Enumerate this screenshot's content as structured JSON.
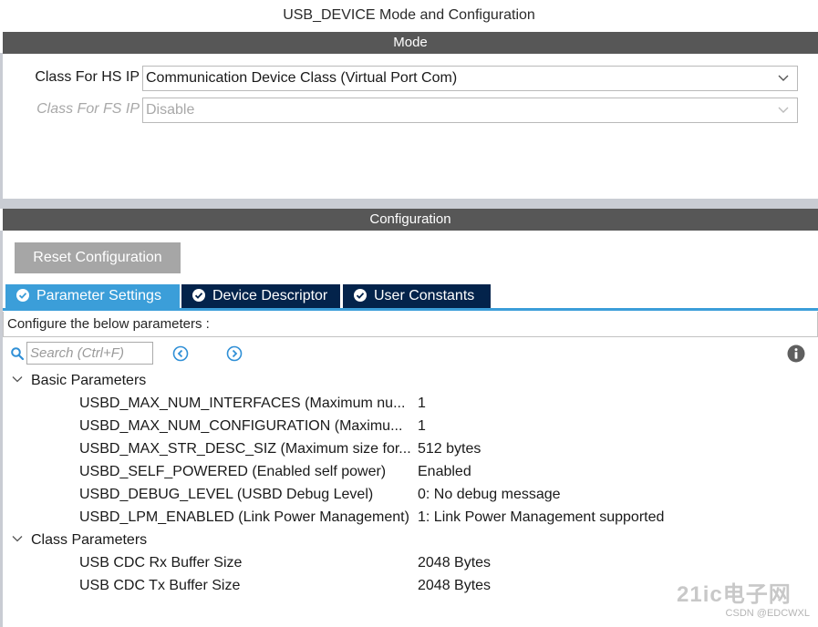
{
  "window": {
    "title": "USB_DEVICE Mode and Configuration"
  },
  "mode": {
    "header": "Mode",
    "hs": {
      "label": "Class For HS IP",
      "value": "Communication Device Class (Virtual Port Com)"
    },
    "fs": {
      "label": "Class For FS IP",
      "value": "Disable"
    }
  },
  "configuration": {
    "header": "Configuration",
    "reset_label": "Reset Configuration",
    "tabs": [
      {
        "label": "Parameter Settings",
        "active": true
      },
      {
        "label": "Device Descriptor",
        "active": false
      },
      {
        "label": "User Constants",
        "active": false
      }
    ],
    "configure_text": "Configure the below parameters :",
    "search": {
      "placeholder": "Search (Ctrl+F)"
    },
    "groups": [
      {
        "name": "Basic Parameters",
        "params": [
          {
            "name": "USBD_MAX_NUM_INTERFACES (Maximum nu...",
            "value": "1"
          },
          {
            "name": "USBD_MAX_NUM_CONFIGURATION (Maximu...",
            "value": "1"
          },
          {
            "name": "USBD_MAX_STR_DESC_SIZ (Maximum size for...",
            "value": "512 bytes"
          },
          {
            "name": "USBD_SELF_POWERED (Enabled self power)",
            "value": "Enabled"
          },
          {
            "name": "USBD_DEBUG_LEVEL (USBD Debug Level)",
            "value": "0: No debug message"
          },
          {
            "name": "USBD_LPM_ENABLED (Link Power Management)",
            "value": "1: Link Power Management supported"
          }
        ]
      },
      {
        "name": "Class Parameters",
        "params": [
          {
            "name": "USB CDC Rx Buffer Size",
            "value": "2048 Bytes"
          },
          {
            "name": "USB CDC Tx Buffer Size",
            "value": "2048 Bytes"
          }
        ]
      }
    ]
  },
  "watermark": {
    "text": "21ic电子网",
    "sub": "CSDN @EDCWXL"
  },
  "icons": {
    "search": "search-icon",
    "prev": "chevron-left-circle-icon",
    "next": "chevron-right-circle-icon",
    "info": "info-icon",
    "tab_tick": "check-circle-icon",
    "dropdown": "chevron-down-icon",
    "group_toggle": "caret-down-icon"
  },
  "colors": {
    "section_bar": "#575757",
    "tab_active": "#3b9ed9",
    "tab_inactive": "#03234b",
    "accent_icon": "#2f8fd6",
    "panel_border": "#c9ccd3"
  }
}
